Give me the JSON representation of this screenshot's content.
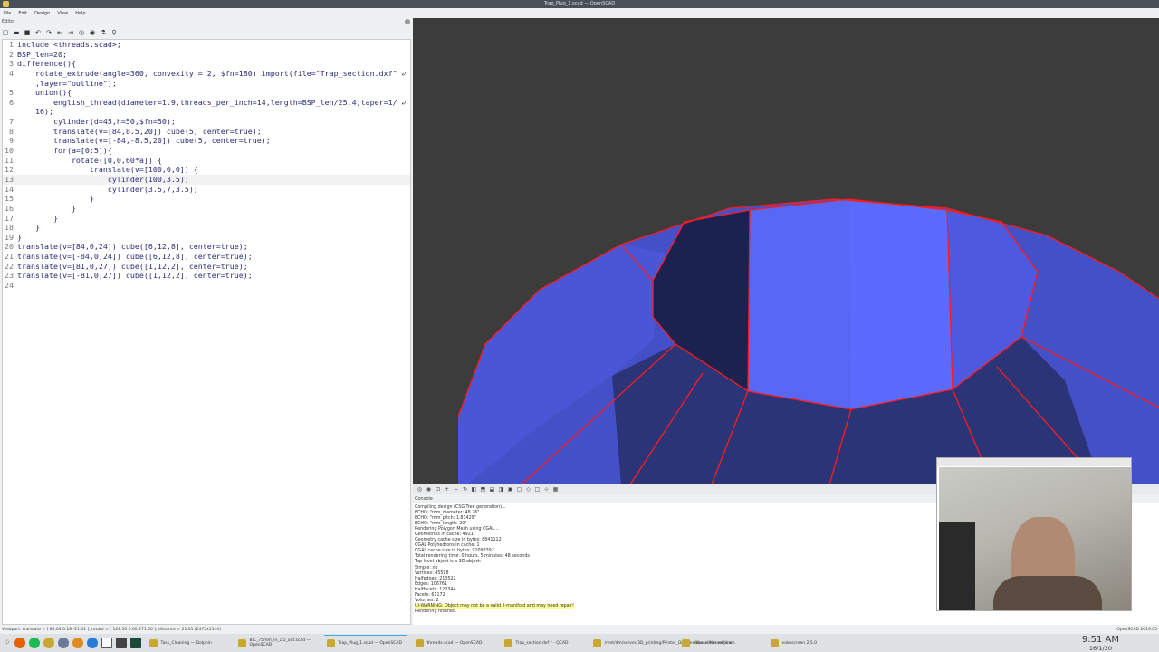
{
  "window": {
    "title": "Trap_Plug_1.scad — OpenSCAD"
  },
  "menu": [
    "File",
    "Edit",
    "Design",
    "View",
    "Help"
  ],
  "editor": {
    "label": "Editor",
    "toolbar_icons": [
      "new-icon",
      "open-icon",
      "save-icon",
      "undo-icon",
      "redo-icon",
      "unindent-icon",
      "indent-icon",
      "preview-icon",
      "render-icon",
      "export-stl-icon",
      "send-to-print-icon"
    ],
    "current_line": 13,
    "lines": [
      {
        "n": "1",
        "t": "include <threads.scad>;"
      },
      {
        "n": "2",
        "t": "BSP_len=20;"
      },
      {
        "n": "3",
        "t": "difference(){"
      },
      {
        "n": "4",
        "t": "    rotate_extrude(angle=360, convexity = 2, $fn=180) import(file=\"Trap_section.dxf\" ⤶"
      },
      {
        "n": "",
        "t": "    ,layer=\"outline\");"
      },
      {
        "n": "5",
        "t": "    union(){"
      },
      {
        "n": "6",
        "t": "        english_thread(diameter=1.9,threads_per_inch=14,length=BSP_len/25.4,taper=1/ ⤶"
      },
      {
        "n": "",
        "t": "    16);"
      },
      {
        "n": "7",
        "t": "        cylinder(d=45,h=50,$fn=50);"
      },
      {
        "n": "8",
        "t": "        translate(v=[84,8.5,20]) cube(5, center=true);"
      },
      {
        "n": "9",
        "t": "        translate(v=[-84,-8.5,20]) cube(5, center=true);"
      },
      {
        "n": "10",
        "t": "        for(a=[0:5]){"
      },
      {
        "n": "11",
        "t": "            rotate([0,0,60*a]) {"
      },
      {
        "n": "12",
        "t": "                translate(v=[100,0,0]) {"
      },
      {
        "n": "13",
        "t": "                    cylinder(100,3.5);"
      },
      {
        "n": "14",
        "t": "                    cylinder(3.5,7,3.5);"
      },
      {
        "n": "15",
        "t": "                }"
      },
      {
        "n": "16",
        "t": "            }"
      },
      {
        "n": "17",
        "t": "        }"
      },
      {
        "n": "18",
        "t": "    }"
      },
      {
        "n": "19",
        "t": "}"
      },
      {
        "n": "20",
        "t": "translate(v=[84,0,24]) cube([6,12,8], center=true);"
      },
      {
        "n": "21",
        "t": "translate(v=[-84,0,24]) cube([6,12,8], center=true);"
      },
      {
        "n": "22",
        "t": "translate(v=[81,0,27]) cube([1,12,2], center=true);"
      },
      {
        "n": "23",
        "t": "translate(v=[-81,0,27]) cube([1,12,2], center=true);"
      },
      {
        "n": "24",
        "t": ""
      }
    ]
  },
  "console": {
    "label": "Console",
    "lines": [
      "Compiling design (CSG Tree generation)...",
      "ECHO: \"mm_diameter: 48.26\"",
      "ECHO: \"mm_pitch: 1.81429\"",
      "ECHO: \"mm_length: 20\"",
      "Rendering Polygon Mesh using CGAL...",
      "Geometries in cache: 4921",
      "Geometry cache size in bytes: 8841112",
      "CGAL Polyhedrons in cache: 1",
      "CGAL cache size in bytes: 92093392",
      "Total rendering time: 0 hours, 5 minutes, 48 seconds",
      "Top level object is a 3D object:",
      "Simple: no",
      "Vertices: 45598",
      "Halfedges: 213522",
      "Edges: 106761",
      "Halffacets: 122344",
      "Facets: 61172",
      "Volumes: 2"
    ],
    "warning": "UI-WARNING: Object may not be a valid 2-manifold and may need repair!",
    "final": "Rendering finished."
  },
  "status": {
    "viewport": "Viewport: translate = [ 88.04 0.18 -21.01 ], rotate = [ 128.50 0.00 271.60 ], distance = 21.01 (2475x1544)",
    "version": "OpenSCAD 2019.05"
  },
  "taskbar": {
    "tasks": [
      {
        "label": "Task_Cleaning — Dolphin",
        "active": false
      },
      {
        "label": "BIC_75mm_in_1.5_out.scad — OpenSCAD",
        "active": false
      },
      {
        "label": "Trap_Plug_1.scad — OpenSCAD",
        "active": true
      },
      {
        "label": "threads.scad — OpenSCAD",
        "active": false
      },
      {
        "label": "Trap_section.dxf * - QCAD",
        "active": false
      },
      {
        "label": "/mnt/dm/server/3D_printing/Printer_Designs/Kossel/Kossel_line...",
        "active": false
      },
      {
        "label": "vokoscreen webcam",
        "active": false
      },
      {
        "label": "vokoscreen 2.5.0",
        "active": false
      }
    ],
    "time": "9:51 AM",
    "date": "16/1/20"
  },
  "colors": {
    "face_light": "#5b6bff",
    "face_mid": "#4350c8",
    "face_dark": "#1c2250",
    "edge": "#ff1a1a",
    "background": "#3c3c3c"
  }
}
